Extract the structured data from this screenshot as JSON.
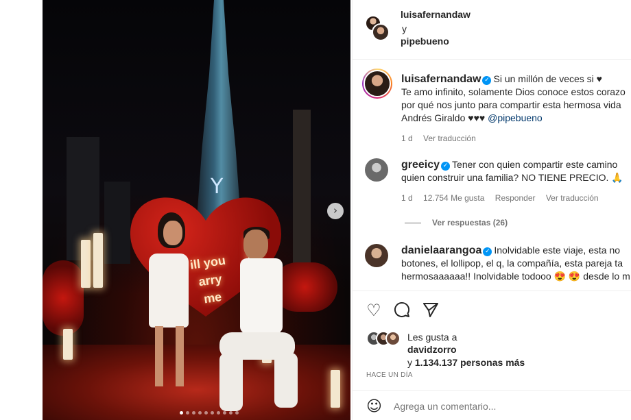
{
  "post": {
    "slide_count": 10,
    "active_slide": 1,
    "next_icon": "chevron-right-icon",
    "photo_sign_lines": [
      "ill you",
      "arry",
      "me"
    ]
  },
  "header": {
    "user1": "luisafernandaw",
    "joiner": "y",
    "user2": "pipebueno"
  },
  "caption": {
    "username": "luisafernandaw",
    "line1": "Si un millón de veces si ♥",
    "line2": "Te amo infinito, solamente Dios conoce estos corazo",
    "line3": "por qué nos junto para compartir esta hermosa vida",
    "line4_text": "Andrés Giraldo ♥♥♥ ",
    "mention": "@pipebueno",
    "age": "1 d",
    "translate": "Ver traducción"
  },
  "comments": [
    {
      "username": "greeicy",
      "line1": "Tener con quien compartir este camino",
      "line2": "quien construir una familia? NO TIENE PRECIO. 🙏",
      "age": "1 d",
      "likes": "12.754 Me gusta",
      "reply": "Responder",
      "translate": "Ver traducción"
    },
    {
      "username": "danielaarangoa",
      "line1": "Inolvidable este viaje, esta no",
      "line2": "botones, el lollipop, el q, la compañía, esta pareja ta",
      "line3_text": "hermosaaaaaa!! Inolvidable todooo 😍 😍  desde lo m"
    }
  ],
  "replies_label": "Ver respuestas (26)",
  "actions": {
    "like_icon": "heart-icon",
    "comment_icon": "comment-icon",
    "share_icon": "send-icon"
  },
  "likes": {
    "prefix": "Les gusta a",
    "user": "davidzorro",
    "suffix_start": "y ",
    "count": "1.134.137 personas más"
  },
  "timestamp": "HACE UN DÍA",
  "add_comment": {
    "placeholder": "Agrega un comentario...",
    "emoji_icon": "emoji-icon"
  },
  "colors": {
    "verified": "#0095f6",
    "text": "#262626",
    "muted": "#737373",
    "mention": "#00376b"
  }
}
